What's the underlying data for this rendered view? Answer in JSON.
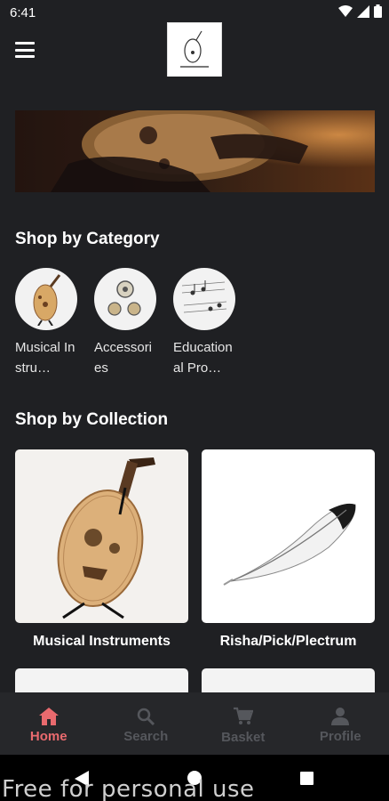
{
  "status": {
    "time": "6:41"
  },
  "colors": {
    "background": "#1f2023",
    "active_tab": "#e96a6e",
    "inactive_tab": "#55575c"
  },
  "sections": {
    "category_title": "Shop by Category",
    "collection_title": "Shop by Collection"
  },
  "categories": [
    {
      "label": "Musical Instru…",
      "icon": "oud-icon"
    },
    {
      "label": "Accessories",
      "icon": "accessories-icon"
    },
    {
      "label": "Educational Pro…",
      "icon": "sheet-music-icon"
    }
  ],
  "collections": [
    {
      "label": "Musical Instruments",
      "icon": "oud-icon"
    },
    {
      "label": "Risha/Pick/Plectrum",
      "icon": "feather-icon"
    }
  ],
  "bottom_nav": [
    {
      "label": "Home",
      "icon": "home-icon",
      "active": true
    },
    {
      "label": "Search",
      "icon": "search-icon",
      "active": false
    },
    {
      "label": "Basket",
      "icon": "cart-icon",
      "active": false
    },
    {
      "label": "Profile",
      "icon": "person-icon",
      "active": false
    }
  ],
  "watermark": "Free for personal use"
}
